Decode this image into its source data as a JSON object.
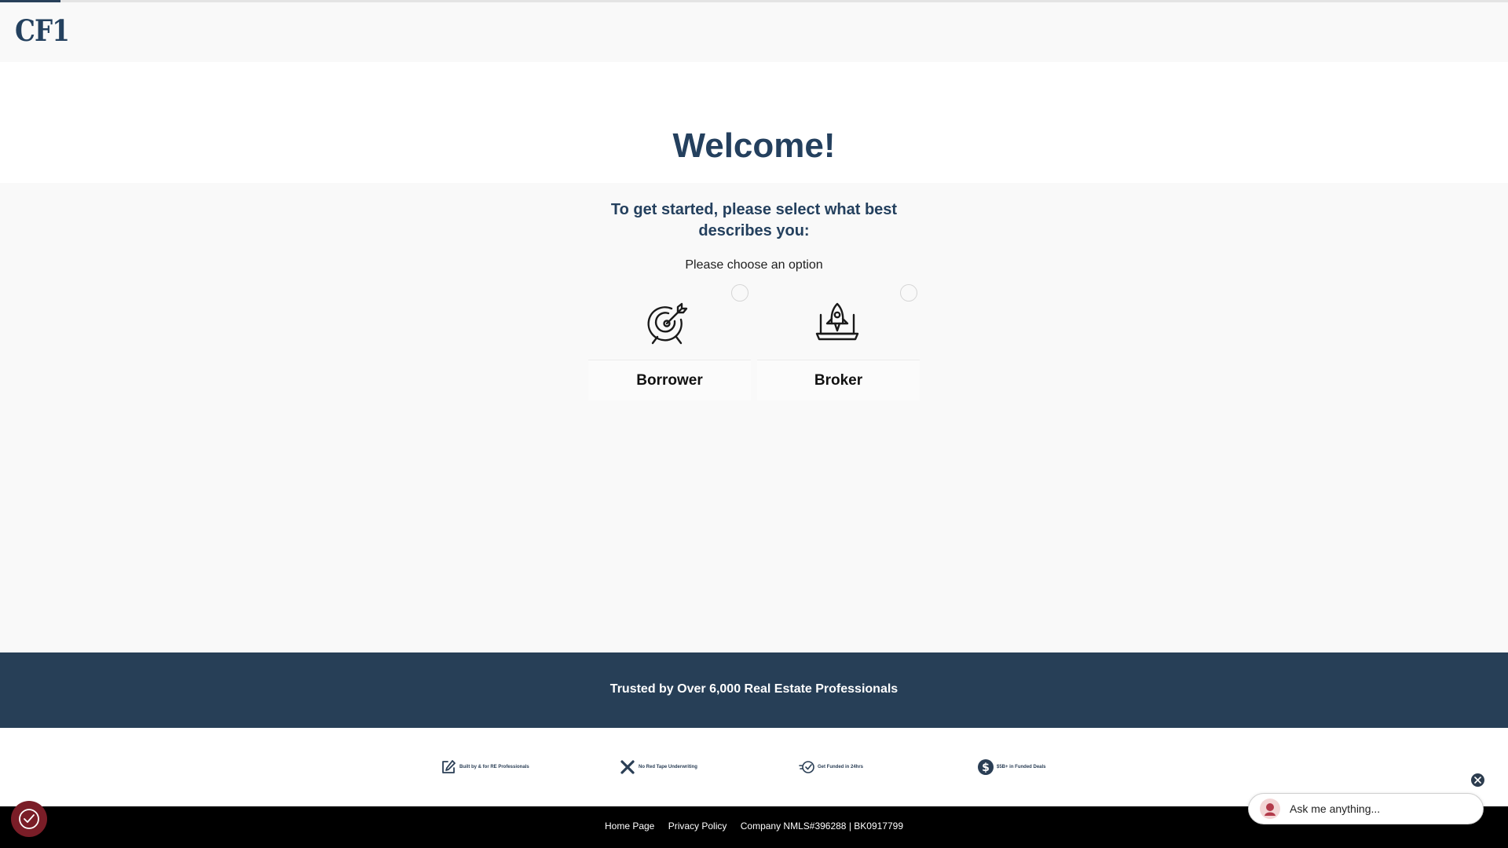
{
  "header": {
    "logo_text": "CF1",
    "progress_fraction": 0.04
  },
  "welcome": {
    "title": "Welcome!"
  },
  "selection": {
    "question": "To get started, please select what best describes you:",
    "hint": "Please choose an option",
    "options": [
      {
        "label": "Borrower",
        "icon": "target-arrow-icon",
        "selected": false
      },
      {
        "label": "Broker",
        "icon": "rocket-laptop-icon",
        "selected": false
      }
    ]
  },
  "trust": {
    "text": "Trusted by Over 6,000 Real Estate Professionals"
  },
  "badges": [
    {
      "text": "Built by & for RE Professionals",
      "icon": "edit-icon"
    },
    {
      "text": "No Red Tape Underwriting",
      "icon": "x-icon"
    },
    {
      "text": "Get Funded in 24hrs",
      "icon": "fast-check-icon"
    },
    {
      "text": "$5B+ in Funded Deals",
      "icon": "dollar-icon"
    }
  ],
  "footer": {
    "home": "Home Page",
    "privacy": "Privacy Policy",
    "nmls": "Company NMLS#396288 | BK0917799"
  },
  "chat": {
    "placeholder": "Ask me anything..."
  },
  "colors": {
    "navy": "#273f57",
    "title": "#24405e",
    "cookie": "#7a1d27"
  }
}
